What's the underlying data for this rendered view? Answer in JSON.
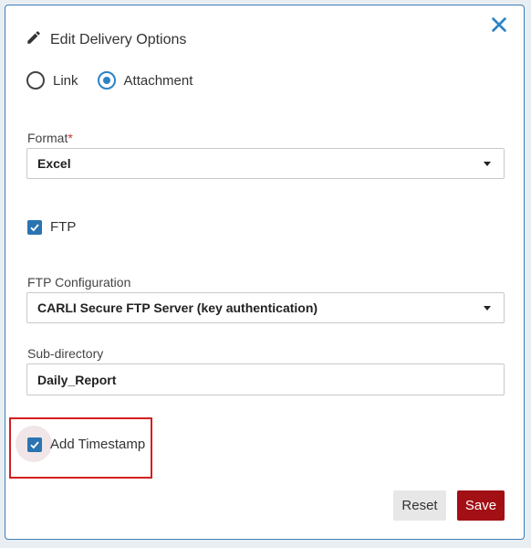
{
  "dialog": {
    "title": "Edit Delivery Options",
    "icons": {
      "title": "pencil-icon",
      "close": "close-icon"
    }
  },
  "delivery_method": {
    "options": [
      {
        "label": "Link",
        "selected": false
      },
      {
        "label": "Attachment",
        "selected": true
      }
    ]
  },
  "format": {
    "label": "Format",
    "required_marker": "*",
    "value": "Excel"
  },
  "ftp": {
    "label": "FTP",
    "checked": true
  },
  "ftp_configuration": {
    "label": "FTP Configuration",
    "value": "CARLI Secure FTP Server (key authentication)"
  },
  "sub_directory": {
    "label": "Sub-directory",
    "value": "Daily_Report"
  },
  "add_timestamp": {
    "label": "Add Timestamp",
    "checked": true
  },
  "actions": {
    "reset_label": "Reset",
    "save_label": "Save"
  },
  "colors": {
    "accent": "#2b73b1",
    "save_button": "#a20f14",
    "highlight_box": "#d41f1f",
    "dialog_border": "#3c7fb6"
  }
}
